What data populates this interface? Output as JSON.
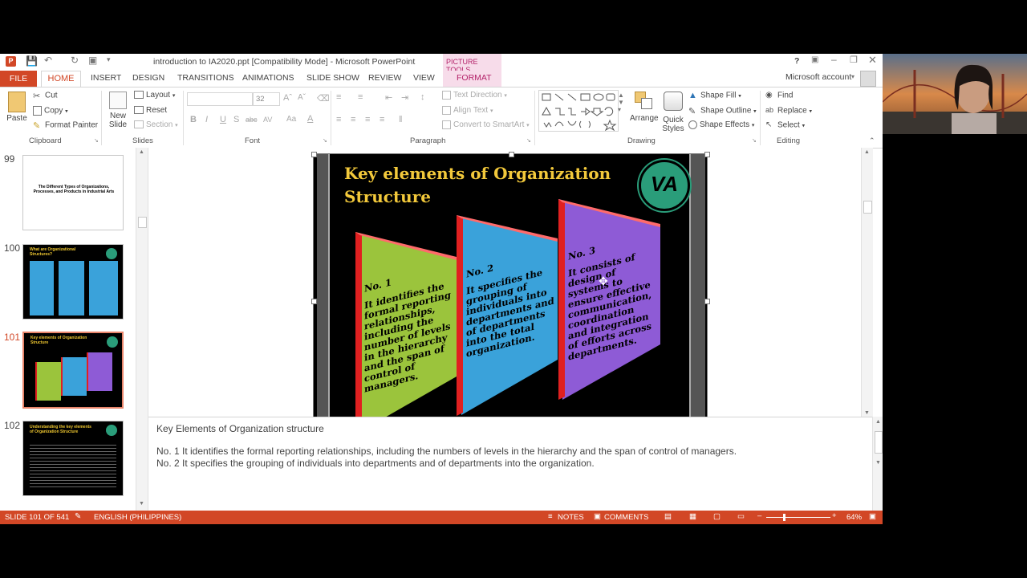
{
  "window": {
    "title": "introduction to IA2020.ppt [Compatibility Mode] - Microsoft PowerPoint",
    "picture_tools": "PICTURE TOOLS",
    "help": "?",
    "account": "Microsoft account"
  },
  "tabs": [
    "FILE",
    "HOME",
    "INSERT",
    "DESIGN",
    "TRANSITIONS",
    "ANIMATIONS",
    "SLIDE SHOW",
    "REVIEW",
    "VIEW",
    "FORMAT"
  ],
  "ribbon": {
    "clipboard": {
      "paste": "Paste",
      "cut": "Cut",
      "copy": "Copy",
      "format_painter": "Format Painter",
      "label": "Clipboard"
    },
    "slides": {
      "new_slide_1": "New",
      "new_slide_2": "Slide",
      "layout": "Layout",
      "reset": "Reset",
      "section": "Section",
      "label": "Slides"
    },
    "font": {
      "size": "32",
      "label": "Font"
    },
    "paragraph": {
      "text_direction": "Text Direction",
      "align_text": "Align Text",
      "smartart": "Convert to SmartArt",
      "label": "Paragraph"
    },
    "drawing": {
      "arrange": "Arrange",
      "quick_styles_1": "Quick",
      "quick_styles_2": "Styles",
      "shape_fill": "Shape Fill",
      "shape_outline": "Shape Outline",
      "shape_effects": "Shape Effects",
      "label": "Drawing"
    },
    "editing": {
      "find": "Find",
      "replace": "Replace",
      "select": "Select",
      "label": "Editing"
    }
  },
  "thumbnails": [
    {
      "num": "99",
      "text": "The Different Types of Organizations, Processes, and Products in Industrial Arts"
    },
    {
      "num": "100",
      "text": "What are Organizational Structures?"
    },
    {
      "num": "101",
      "text": "Key elements of Organization Structure"
    },
    {
      "num": "102",
      "text": "Understanding the key elements of Organization Structure"
    }
  ],
  "slide": {
    "title_line1": "Key elements of Organization",
    "title_line2": "Structure",
    "logo": "VA",
    "panels": [
      {
        "heading": "No. 1",
        "body": "It identifies the formal reporting relationships, including the number of levels in the hierarchy and the span of control of managers.",
        "color": "#9bc43c"
      },
      {
        "heading": "No. 2",
        "body": "It specifies the grouping of individuals into departments and of departments into the total organization.",
        "color": "#3aa2da"
      },
      {
        "heading": "No. 3",
        "body": "It consists of design of systems to ensure effective communication, coordination and integration of efforts across departments.",
        "color": "#8e5bd6"
      }
    ]
  },
  "notes": {
    "line1": "Key Elements of Organization structure",
    "line2": "No. 1 It identifies the formal reporting relationships, including the numbers of levels in the hierarchy and the span of control of managers.",
    "line3": "No. 2 It specifies the grouping of individuals into departments and of departments into the organization."
  },
  "status": {
    "slide_count": "SLIDE 101 OF 541",
    "language": "ENGLISH (PHILIPPINES)",
    "notes": "NOTES",
    "comments": "COMMENTS",
    "zoom": "64%"
  }
}
